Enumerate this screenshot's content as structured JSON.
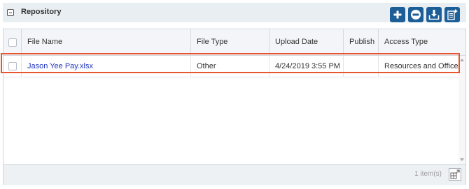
{
  "panel": {
    "title": "Repository",
    "toolbar": [
      {
        "name": "add-icon"
      },
      {
        "name": "remove-icon"
      },
      {
        "name": "download-icon"
      },
      {
        "name": "add-document-icon"
      }
    ]
  },
  "table": {
    "columns": [
      "File Name",
      "File Type",
      "Upload Date",
      "Publish",
      "Access Type"
    ],
    "rows": [
      {
        "file_name": "Jason Yee Pay.xlsx",
        "file_type": "Other",
        "upload_date": "4/24/2019 3:55 PM",
        "publish": "",
        "access_type": "Resources and Office"
      }
    ]
  },
  "footer": {
    "item_count": "1 item(s)"
  },
  "colors": {
    "accent": "#1c5e98",
    "highlight": "#e8552f",
    "link": "#2336c0"
  }
}
